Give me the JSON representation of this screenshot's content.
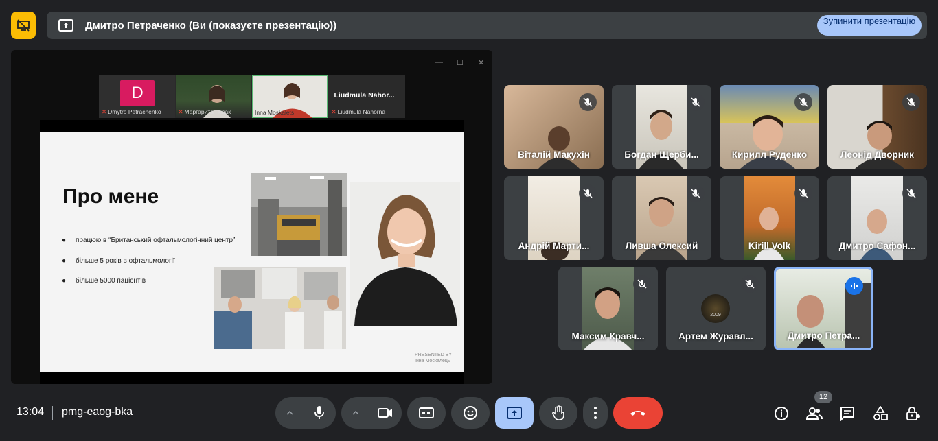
{
  "banner": {
    "text": "Дмитро Петраченко (Ви (показуєте презентацію))",
    "stop_label": "Зупинити презентацію"
  },
  "presentation": {
    "window_controls": [
      "—",
      "☐",
      "✕"
    ],
    "tiles": [
      {
        "name": "Dmytro Petrachenko",
        "avatar_letter": "D"
      },
      {
        "name": "Маргарита Чєсак"
      },
      {
        "name": "Inna Moskalets"
      },
      {
        "name": "Liudmula Nahorna",
        "big_label": "Liudmula  Nahor..."
      }
    ],
    "slide": {
      "title": "Про мене",
      "bullets": [
        "працюю в “Британський офтальмологічний центр”",
        "більше 5 років в офтальмології",
        "більше 5000 пацієнтів"
      ],
      "presented_by": "PRESENTED BY",
      "presenter": "Інна Москалець",
      "bullet_glyph": "●"
    }
  },
  "participants": [
    {
      "name": "Віталій Макухін",
      "muted": true
    },
    {
      "name": "Богдан Щерби...",
      "muted": true
    },
    {
      "name": "Кирилл Руденко",
      "muted": true
    },
    {
      "name": "Леонід Дворник",
      "muted": true
    },
    {
      "name": "Андрій Марти...",
      "muted": true
    },
    {
      "name": "Ливша Олексий",
      "muted": true
    },
    {
      "name": "Kirill Volk",
      "muted": true
    },
    {
      "name": "Дмитро Сафон...",
      "muted": true
    },
    {
      "name": "Максим Кравч...",
      "muted": true
    },
    {
      "name": "Артем Журавл...",
      "muted": true,
      "avatar_text": "2009"
    },
    {
      "name": "Дмитро Петра...",
      "muted": false,
      "speaking": true
    }
  ],
  "bottom": {
    "time": "13:04",
    "meeting_code": "pmg-eaog-bka",
    "people_count": "12"
  },
  "colors": {
    "background": "#202124",
    "tile": "#3c4043",
    "accent_blue": "#a8c7fa",
    "end_call_red": "#ea4335",
    "hide_yellow": "#fbbc04"
  }
}
